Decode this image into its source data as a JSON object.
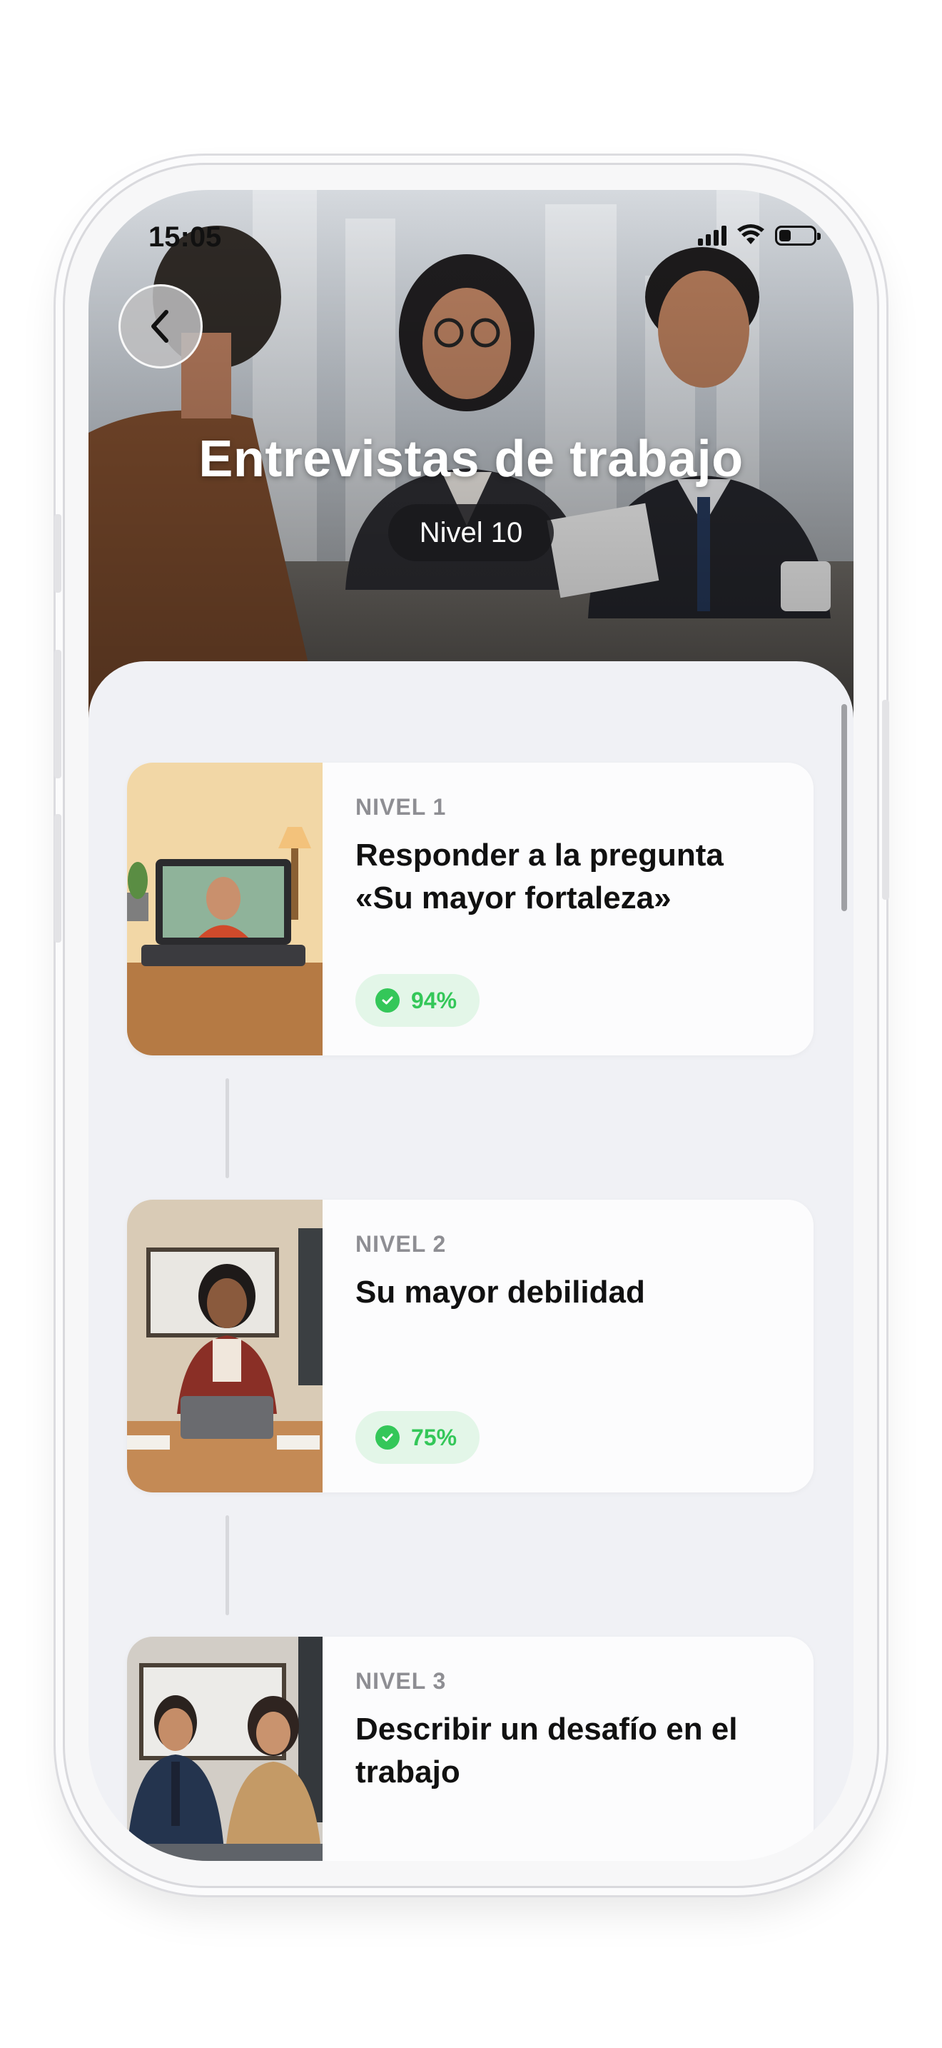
{
  "status_bar": {
    "time": "15:05"
  },
  "header": {
    "title": "Entrevistas de trabajo",
    "level_badge": "Nivel 10"
  },
  "lessons": [
    {
      "level": "NIVEL 1",
      "title": "Responder a la pregunta «Su mayor fortaleza»",
      "score": "94%"
    },
    {
      "level": "NIVEL 2",
      "title": "Su mayor debilidad",
      "score": "75%"
    },
    {
      "level": "NIVEL 3",
      "title": "Describir un desafío en el trabajo"
    }
  ],
  "colors": {
    "score_green": "#34c759",
    "score_bg": "#e3f6e8",
    "sheet_bg": "#f0f1f5"
  },
  "icons": [
    "back-chevron-icon",
    "signal-icon",
    "wifi-icon",
    "battery-icon",
    "check-circle-icon"
  ]
}
